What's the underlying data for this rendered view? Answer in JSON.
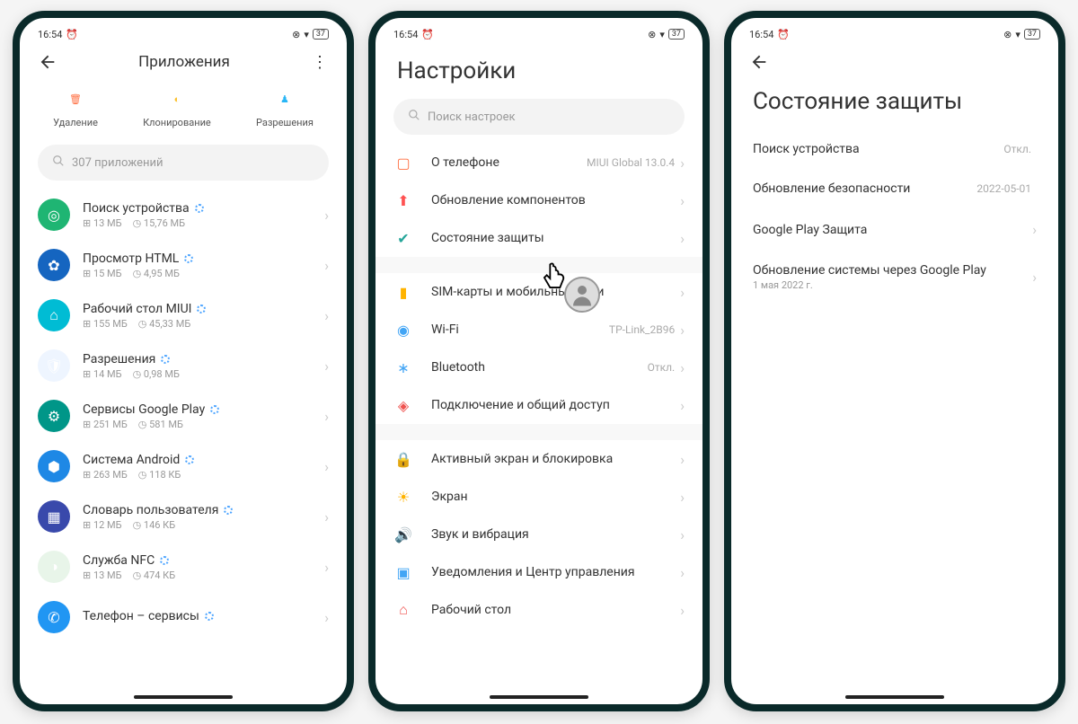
{
  "statusbar": {
    "time": "16:54",
    "battery": "37"
  },
  "screen1": {
    "title": "Приложения",
    "actions": {
      "delete": "Удаление",
      "clone": "Клонирование",
      "perms": "Разрешения"
    },
    "search_placeholder": "307 приложений",
    "apps": [
      {
        "name": "Поиск устройства",
        "storage": "13 МБ",
        "data": "15,76 МБ",
        "icon_bg": "#1fb573",
        "icon_glyph": "◎"
      },
      {
        "name": "Просмотр HTML",
        "storage": "15 МБ",
        "data": "4,95 МБ",
        "icon_bg": "#1565c0",
        "icon_glyph": "✿"
      },
      {
        "name": "Рабочий стол MIUI",
        "storage": "155 МБ",
        "data": "45,33 МБ",
        "icon_bg": "#00bcd4",
        "icon_glyph": "⌂"
      },
      {
        "name": "Разрешения",
        "storage": "14 МБ",
        "data": "0,98 МБ",
        "icon_bg": "#eef5ff",
        "icon_glyph": "🛡"
      },
      {
        "name": "Сервисы Google Play",
        "storage": "251 МБ",
        "data": "581 МБ",
        "icon_bg": "#009688",
        "icon_glyph": "⚙"
      },
      {
        "name": "Система Android",
        "storage": "263 МБ",
        "data": "118 КБ",
        "icon_bg": "#1e88e5",
        "icon_glyph": "⬢"
      },
      {
        "name": "Словарь пользователя",
        "storage": "12 МБ",
        "data": "146 КБ",
        "icon_bg": "#3949ab",
        "icon_glyph": "▦"
      },
      {
        "name": "Служба NFC",
        "storage": "13 МБ",
        "data": "474 КБ",
        "icon_bg": "#e8f5e9",
        "icon_glyph": "◑"
      },
      {
        "name": "Телефон – сервисы",
        "storage": "",
        "data": "",
        "icon_bg": "#2196f3",
        "icon_glyph": "✆"
      }
    ]
  },
  "screen2": {
    "title": "Настройки",
    "search_placeholder": "Поиск настроек",
    "groups": [
      [
        {
          "icon": "phone-icon",
          "color": "#ff7043",
          "label": "О телефоне",
          "value": "MIUI Global 13.0.4"
        },
        {
          "icon": "update-icon",
          "color": "#ff5252",
          "label": "Обновление компонентов",
          "value": ""
        },
        {
          "icon": "shield-icon",
          "color": "#26a69a",
          "label": "Состояние защиты",
          "value": ""
        }
      ],
      [
        {
          "icon": "sim-icon",
          "color": "#ffb300",
          "label": "SIM-карты и мобильные сети",
          "value": ""
        },
        {
          "icon": "wifi-icon",
          "color": "#42a5f5",
          "label": "Wi-Fi",
          "value": "TP-Link_2B96"
        },
        {
          "icon": "bluetooth-icon",
          "color": "#42a5f5",
          "label": "Bluetooth",
          "value": "Откл."
        },
        {
          "icon": "share-icon",
          "color": "#ef5350",
          "label": "Подключение и общий доступ",
          "value": ""
        }
      ],
      [
        {
          "icon": "lock-icon",
          "color": "#ef5350",
          "label": "Активный экран и блокировка",
          "value": ""
        },
        {
          "icon": "brightness-icon",
          "color": "#ffb300",
          "label": "Экран",
          "value": ""
        },
        {
          "icon": "sound-icon",
          "color": "#26a69a",
          "label": "Звук и вибрация",
          "value": ""
        },
        {
          "icon": "notif-icon",
          "color": "#42a5f5",
          "label": "Уведомления и Центр управления",
          "value": ""
        },
        {
          "icon": "home-icon",
          "color": "#ef5350",
          "label": "Рабочий стол",
          "value": ""
        }
      ]
    ]
  },
  "screen3": {
    "title": "Состояние защиты",
    "items": [
      {
        "label": "Поиск устройства",
        "value": "Откл.",
        "chevron": false,
        "sub": ""
      },
      {
        "label": "Обновление безопасности",
        "value": "2022-05-01",
        "chevron": false,
        "sub": ""
      },
      {
        "label": "Google Play Защита",
        "value": "",
        "chevron": true,
        "sub": ""
      },
      {
        "label": "Обновление системы через Google Play",
        "value": "",
        "chevron": true,
        "sub": "1 мая 2022 г."
      }
    ]
  }
}
